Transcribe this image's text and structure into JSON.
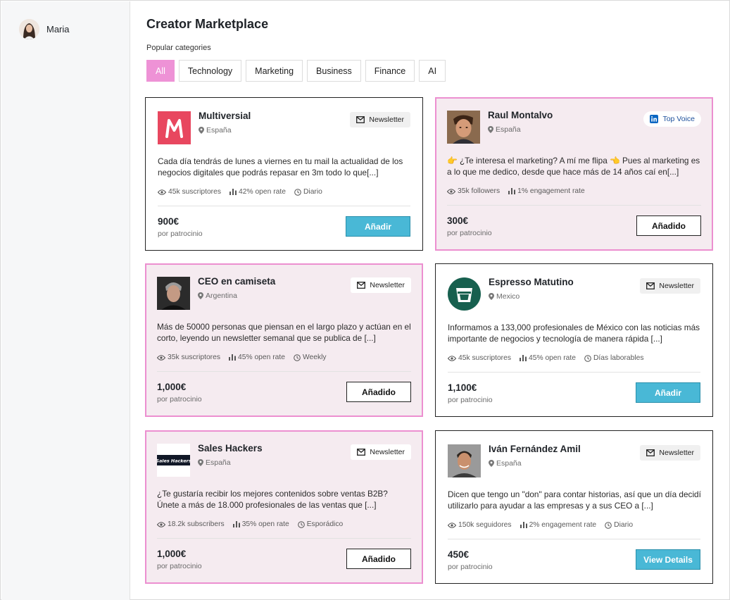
{
  "user": {
    "name": "Maria"
  },
  "page": {
    "title": "Creator Marketplace",
    "categories_label": "Popular categories"
  },
  "categories": [
    {
      "label": "All",
      "active": true
    },
    {
      "label": "Technology",
      "active": false
    },
    {
      "label": "Marketing",
      "active": false
    },
    {
      "label": "Business",
      "active": false
    },
    {
      "label": "Finance",
      "active": false
    },
    {
      "label": "AI",
      "active": false
    }
  ],
  "colors": {
    "accent_pink": "#ee92d6",
    "selected_bg": "#f5ebf0",
    "primary_button": "#49b8d6",
    "linkedin_blue": "#0a66c2"
  },
  "cards": [
    {
      "name": "Multiversial",
      "location": "España",
      "badge": "Newsletter",
      "badge_icon": "mail-icon",
      "description": "Cada día tendrás de lunes a viernes en tu mail la actualidad de los negocios digitales que podrás repasar en 3m todo lo que[...]",
      "stat1": "45k suscriptores",
      "stat2": "42% open rate",
      "stat3": "Diario",
      "price": "900€",
      "price_note": "por patrocinio",
      "button": "Añadir",
      "selected": false
    },
    {
      "name": "Raul Montalvo",
      "location": "España",
      "badge": "Top Voice",
      "badge_icon": "linkedin-icon",
      "description": "👉 ¿Te interesa el marketing? A mí me flipa 👈 Pues al marketing es a lo que me dedico, desde que hace más de 14 años caí en[...]",
      "stat1": "35k followers",
      "stat2": "1% engagement rate",
      "stat3": "",
      "price": "300€",
      "price_note": "por patrocinio",
      "button": "Añadido",
      "selected": true
    },
    {
      "name": "CEO en camiseta",
      "location": "Argentina",
      "badge": "Newsletter",
      "badge_icon": "mail-icon",
      "description": "Más de 50000 personas que piensan en el largo plazo y actúan en el corto, leyendo un newsletter semanal que se publica de [...]",
      "stat1": "35k suscriptores",
      "stat2": "45% open rate",
      "stat3": "Weekly",
      "price": "1,000€",
      "price_note": "por patrocinio",
      "button": "Añadido",
      "selected": true
    },
    {
      "name": "Espresso Matutino",
      "location": "Mexico",
      "badge": "Newsletter",
      "badge_icon": "mail-icon",
      "description": "Informamos a 133,000 profesionales de México con las noticias más importante de negocios y tecnología de manera rápida [...]",
      "stat1": "45k suscriptores",
      "stat2": "45% open rate",
      "stat3": "Días laborables",
      "price": "1,100€",
      "price_note": "por patrocinio",
      "button": "Añadir",
      "selected": false
    },
    {
      "name": "Sales Hackers",
      "location": "España",
      "badge": "Newsletter",
      "badge_icon": "mail-icon",
      "logo_text": "Sales Hackers",
      "description": "¿Te gustaría recibir los mejores contenidos sobre ventas B2B? Únete a más de 18.000 profesionales de las ventas que [...]",
      "stat1": "18.2k subscribers",
      "stat2": "35% open rate",
      "stat3": "Esporádico",
      "price": "1,000€",
      "price_note": "por patrocinio",
      "button": "Añadido",
      "selected": true
    },
    {
      "name": "Iván Fernández Amil",
      "location": "España",
      "badge": "Newsletter",
      "badge_icon": "mail-icon",
      "description": "Dicen que tengo un \"don\" para contar historias, así que un día decidí utilizarlo para ayudar a las empresas y a sus CEO a [...]",
      "stat1": "150k seguidores",
      "stat2": "2% engagement rate",
      "stat3": "Diario",
      "price": "450€",
      "price_note": "por patrocinio",
      "button": "View Details",
      "selected": false
    }
  ]
}
